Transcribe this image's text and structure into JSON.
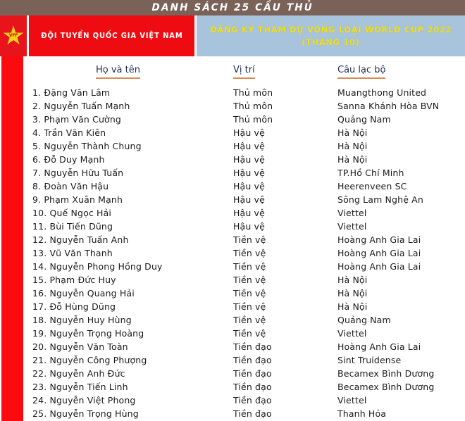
{
  "topbar": {
    "title": "DANH SÁCH 25 CẦU THỦ"
  },
  "banner": {
    "logo_icon": "vietnam-star-icon",
    "logo_text": "VFF",
    "team_label": "ĐỘI TUYỂN QUỐC GIA VIỆT NAM",
    "event_line1": "ĐĂNG KÝ THAM DỰ VÒNG LOẠI WORLD CUP 2022",
    "event_line2": "(THÁNG 10)"
  },
  "colors": {
    "topbar_bg": "#7a6258",
    "red": "#ef0b12",
    "stripe_red": "#fb0a10",
    "blue": "#a8c4dc",
    "yellow": "#f2e00d",
    "header_text": "#1f3050",
    "underline": "#d98a5a"
  },
  "table": {
    "headers": {
      "name": "Họ và tên",
      "position": "Vị trí",
      "club": "Câu lạc bộ"
    },
    "rows": [
      {
        "no": "1.",
        "name": "Đặng Văn Lâm",
        "position": "Thủ môn",
        "club": "Muangthong United"
      },
      {
        "no": "2.",
        "name": "Nguyễn Tuấn Mạnh",
        "position": "Thủ môn",
        "club": "Sanna Khánh Hòa BVN"
      },
      {
        "no": "3.",
        "name": "Phạm Văn Cường",
        "position": "Thủ môn",
        "club": "Quảng Nam"
      },
      {
        "no": "4.",
        "name": "Trần Văn Kiên",
        "position": "Hậu vệ",
        "club": "Hà Nội"
      },
      {
        "no": "5.",
        "name": "Nguyễn Thành Chung",
        "position": "Hậu vệ",
        "club": "Hà Nội"
      },
      {
        "no": "6.",
        "name": "Đỗ Duy Mạnh",
        "position": "Hậu vệ",
        "club": "Hà Nội"
      },
      {
        "no": "7.",
        "name": "Nguyễn Hữu Tuấn",
        "position": "Hậu vệ",
        "club": "TP.Hồ Chí Minh"
      },
      {
        "no": "8.",
        "name": "Đoàn Văn Hậu",
        "position": "Hậu vệ",
        "club": "Heerenveen SC"
      },
      {
        "no": "9.",
        "name": "Phạm Xuân Mạnh",
        "position": "Hậu vệ",
        "club": "Sông Lam Nghệ An"
      },
      {
        "no": "10.",
        "name": "Quế Ngọc Hải",
        "position": "Hậu vệ",
        "club": "Viettel"
      },
      {
        "no": "11.",
        "name": "Bùi Tiến Dũng",
        "position": "Hậu vệ",
        "club": "Viettel"
      },
      {
        "no": "12.",
        "name": "Nguyễn Tuấn Anh",
        "position": "Tiền vệ",
        "club": "Hoàng Anh Gia Lai"
      },
      {
        "no": "13.",
        "name": "Vũ Văn Thanh",
        "position": "Tiền vệ",
        "club": "Hoàng Anh Gia Lai"
      },
      {
        "no": "14.",
        "name": "Nguyễn Phong Hồng Duy",
        "position": "Tiền vệ",
        "club": "Hoàng Anh Gia Lai"
      },
      {
        "no": "15.",
        "name": "Phạm Đức Huy",
        "position": "Tiền vệ",
        "club": "Hà Nội"
      },
      {
        "no": "16.",
        "name": "Nguyễn Quang Hải",
        "position": "Tiền vệ",
        "club": "Hà Nội"
      },
      {
        "no": "17.",
        "name": "Đỗ Hùng Dũng",
        "position": "Tiền vệ",
        "club": "Hà Nội"
      },
      {
        "no": "18.",
        "name": "Nguyễn Huy Hùng",
        "position": "Tiền vệ",
        "club": "Quảng Nam"
      },
      {
        "no": "19.",
        "name": "Nguyễn Trọng Hoàng",
        "position": "Tiền vệ",
        "club": "Viettel"
      },
      {
        "no": "20.",
        "name": "Nguyễn Văn Toàn",
        "position": "Tiền đạo",
        "club": "Hoàng Anh Gia Lai"
      },
      {
        "no": "21.",
        "name": "Nguyễn Công Phượng",
        "position": "Tiền đạo",
        "club": "Sint Truidense"
      },
      {
        "no": "22.",
        "name": "Nguyễn Anh Đức",
        "position": "Tiền đạo",
        "club": "Becamex Bình Dương"
      },
      {
        "no": "23.",
        "name": "Nguyễn Tiến Linh",
        "position": "Tiền đạo",
        "club": "Becamex Bình Dương"
      },
      {
        "no": "24.",
        "name": "Nguyễn Việt Phong",
        "position": "Tiền đạo",
        "club": "Viettel"
      },
      {
        "no": "25.",
        "name": "Nguyễn Trọng Hùng",
        "position": "Tiền đạo",
        "club": "Thanh Hóa"
      }
    ]
  }
}
